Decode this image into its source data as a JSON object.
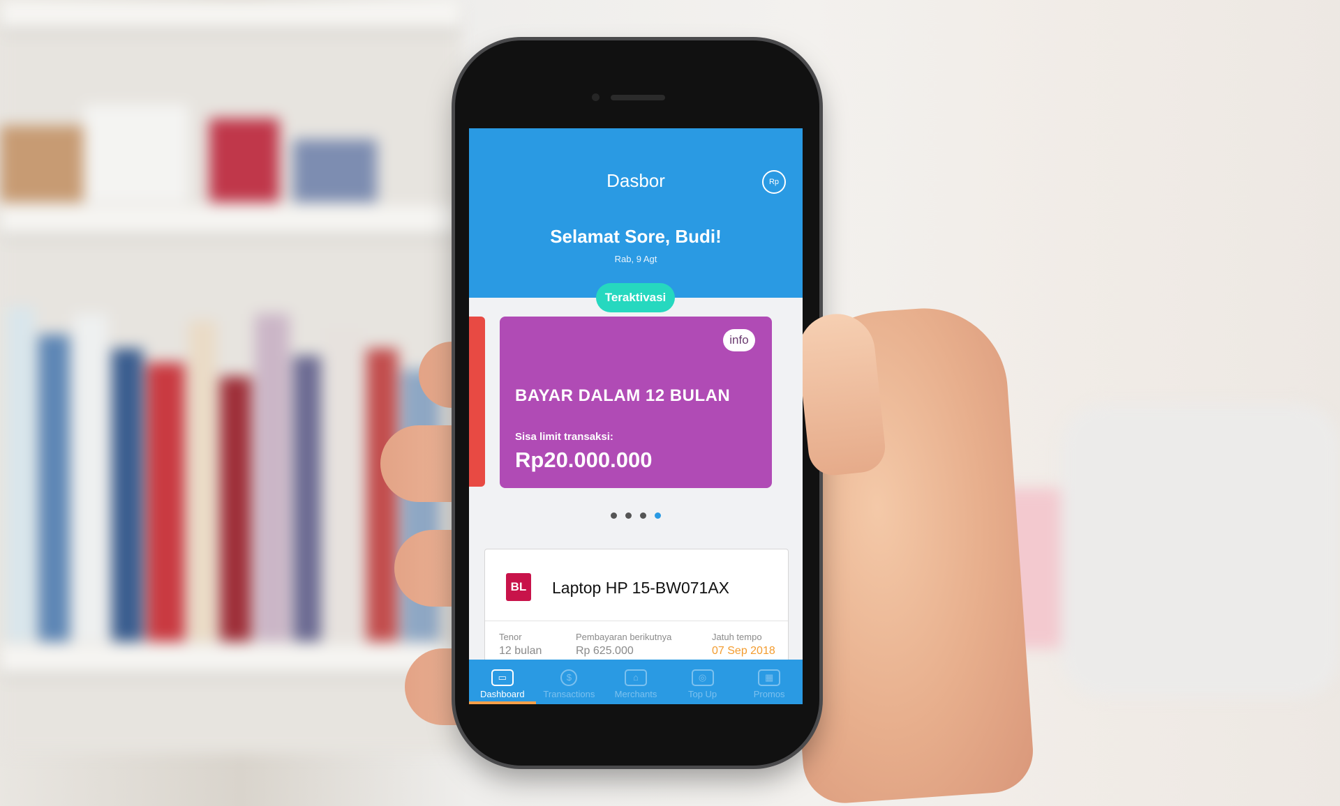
{
  "app": {
    "title": "Dasbor",
    "profile_icon": "Rp",
    "greeting": "Selamat Sore, Budi!",
    "date": "Rab, 9 Agt",
    "status_badge": "Teraktivasi"
  },
  "card": {
    "info_label": "info",
    "title": "BAYAR DALAM 12 BULAN",
    "limit_label": "Sisa limit transaksi:",
    "limit_value": "Rp20.000.000",
    "background": "#b04bb5",
    "pager": {
      "count": 4,
      "active_index": 3
    }
  },
  "transaction": {
    "merchant_logo": "BL",
    "product": "Laptop HP 15-BW071AX",
    "tenor_label": "Tenor",
    "tenor_value": "12 bulan",
    "next_payment_label": "Pembayaran berikutnya",
    "next_payment_value": "Rp 625.000",
    "due_label": "Jatuh tempo",
    "due_value": "07 Sep 2018"
  },
  "tabs": [
    {
      "label": "Dashboard",
      "icon": "card-icon",
      "active": true
    },
    {
      "label": "Transactions",
      "icon": "dollar-icon",
      "active": false
    },
    {
      "label": "Merchants",
      "icon": "store-icon",
      "active": false
    },
    {
      "label": "Top Up",
      "icon": "topup-icon",
      "active": false
    },
    {
      "label": "Promos",
      "icon": "promo-icon",
      "active": false
    }
  ],
  "colors": {
    "header_blue": "#2a9ae3",
    "teal_badge": "#26d8bf",
    "peek_card": "#e84a43",
    "merchant_red": "#c8134a",
    "due_orange": "#f39c2f"
  }
}
